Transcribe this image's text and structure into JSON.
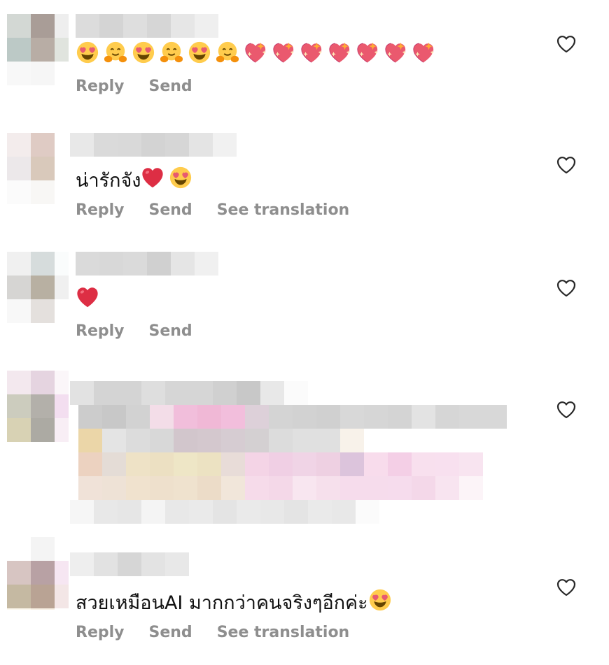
{
  "actions": {
    "reply": "Reply",
    "send": "Send",
    "see_translation": "See translation"
  },
  "comments": [
    {
      "text": "",
      "emojis": [
        "heart-eyes",
        "hug",
        "heart-eyes",
        "hug",
        "heart-eyes",
        "hug",
        "sparkling-heart",
        "sparkling-heart",
        "sparkling-heart",
        "sparkling-heart",
        "sparkling-heart",
        "sparkling-heart",
        "sparkling-heart"
      ],
      "has_translation": false
    },
    {
      "text": "น่ารักจัง",
      "emojis": [
        "red-heart",
        "heart-eyes"
      ],
      "has_translation": true
    },
    {
      "text": "",
      "emojis": [
        "red-heart"
      ],
      "has_translation": false
    },
    {
      "text": "",
      "emojis": [],
      "has_translation": false,
      "blurred": true
    },
    {
      "text": "สวยเหมือนAI มากกว่าคนจริงๆอีกค่ะ",
      "emojis": [
        "heart-eyes"
      ],
      "has_translation": true
    }
  ],
  "colors": {
    "action_text": "#8e8e8e",
    "comment_text": "#111111",
    "background": "#ffffff"
  }
}
